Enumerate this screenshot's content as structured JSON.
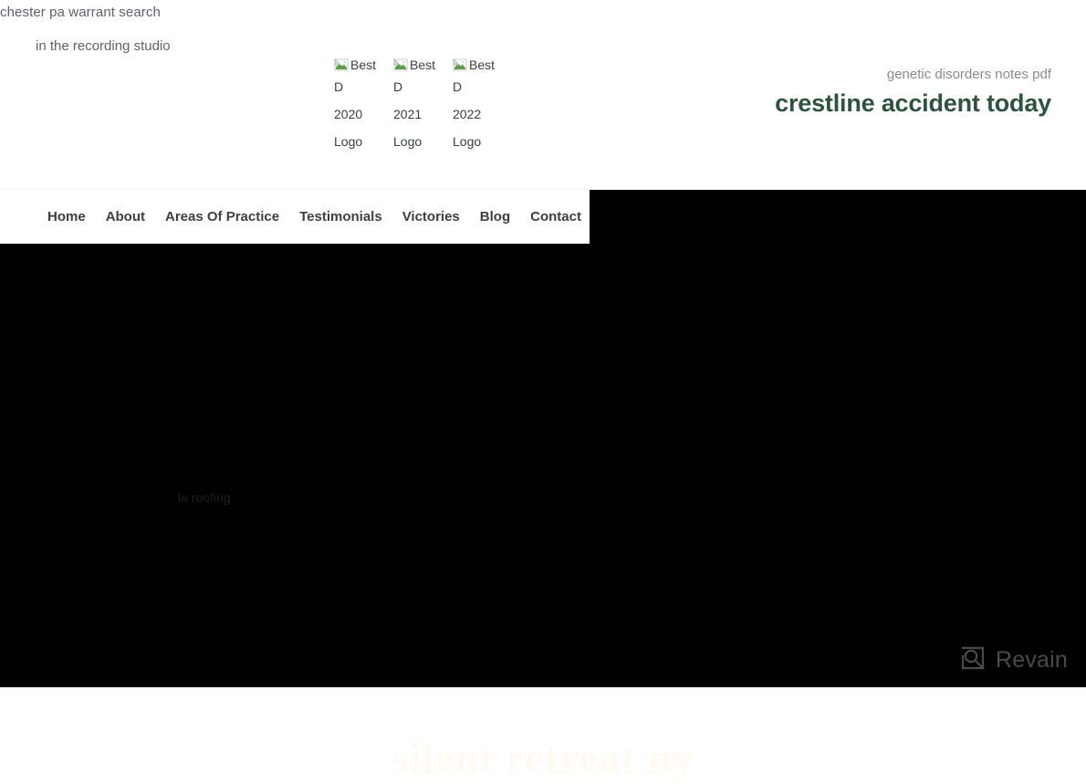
{
  "page": {
    "background_white": "#ffffff",
    "background_hero": "#000000",
    "brand_green": "#2d5440"
  },
  "header": {
    "keyword_top_left": "chester pa warrant search",
    "keyword_second": "in the recording studio",
    "keyword_right_small": "genetic disorders notes pdf",
    "site_title": "crestline accident today"
  },
  "badges": [
    {
      "icon": "broken-image-icon",
      "line1": "Best",
      "line2": "D",
      "line3": "2020",
      "line4": "Logo",
      "alt": "Best D 2020 Logo"
    },
    {
      "icon": "broken-image-icon",
      "line1": "Best",
      "line2": "D",
      "line3": "2021",
      "line4": "Logo",
      "alt": "Best D 2021 Logo"
    },
    {
      "icon": "broken-image-icon",
      "line1": "Best",
      "line2": "D",
      "line3": "2022",
      "line4": "Logo",
      "alt": "Best D 2022 Logo"
    }
  ],
  "nav": {
    "items": [
      {
        "label": "Home"
      },
      {
        "label": "About"
      },
      {
        "label": "Areas Of Practice"
      },
      {
        "label": "Testimonials"
      },
      {
        "label": "Victories"
      },
      {
        "label": "Blog"
      },
      {
        "label": "Contact"
      }
    ]
  },
  "hero": {
    "keyword": "la roofing",
    "title": "silent retreat ny"
  },
  "watermark": {
    "icon": "revain-logo-icon",
    "text": "Revain"
  }
}
